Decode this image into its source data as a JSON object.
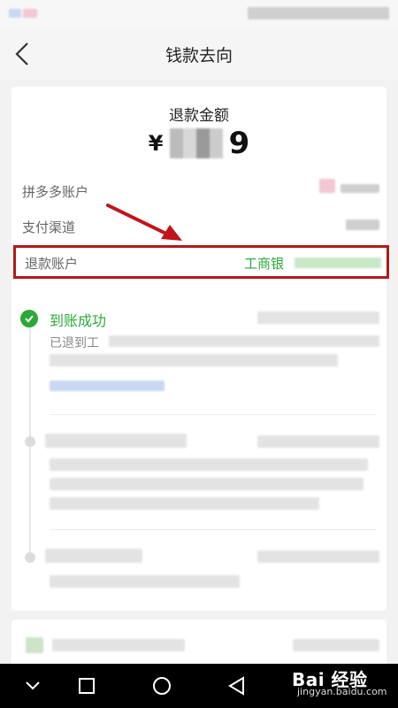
{
  "header": {
    "title": "钱款去向"
  },
  "refund": {
    "amount_label": "退款金额",
    "currency": "¥",
    "amount_visible_digit": "9",
    "rows": [
      {
        "label": "拼多多账户"
      },
      {
        "label": "支付渠道"
      }
    ],
    "refund_account_label": "退款账户",
    "refund_account_value": "工商银"
  },
  "timeline": {
    "step1_title": "到账成功",
    "step1_desc": "已退到工"
  },
  "watermark": {
    "brand": "Bai 经验",
    "url": "jingyan.baidu.com"
  },
  "colors": {
    "success_green": "#2ca83a",
    "highlight_red": "#b11a1a",
    "annotation_arrow": "#c0141a"
  }
}
